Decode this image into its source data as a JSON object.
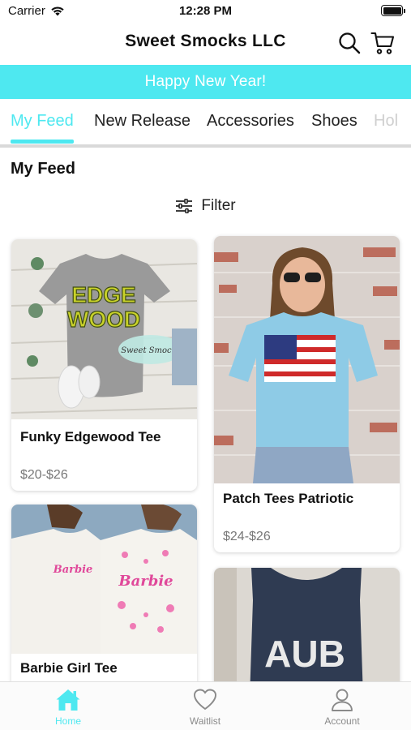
{
  "status_bar": {
    "carrier": "Carrier",
    "time": "12:28 PM"
  },
  "header": {
    "title": "Sweet Smocks LLC"
  },
  "banner": {
    "text": "Happy New Year!",
    "color": "#4ee8f0"
  },
  "tabs": [
    {
      "label": "My Feed",
      "active": true
    },
    {
      "label": "New Release"
    },
    {
      "label": "Accessories"
    },
    {
      "label": "Shoes"
    },
    {
      "label": "Hol"
    }
  ],
  "section_title": "My Feed",
  "filter_label": "Filter",
  "products": [
    {
      "name": "Funky Edgewood Tee",
      "price": "$20-$26",
      "image_text": [
        "EDGE",
        "WOOD"
      ],
      "logo_text": "Sweet Smocks"
    },
    {
      "name": "Patch Tees Patriotic",
      "price": "$24-$26"
    },
    {
      "name": "Barbie Girl Tee",
      "price": "",
      "image_text": [
        "Barbie",
        "Barbie"
      ]
    },
    {
      "name": "",
      "price": "",
      "image_text": [
        "AUB"
      ]
    }
  ],
  "bottom_nav": [
    {
      "label": "Home",
      "icon": "home-icon",
      "active": true
    },
    {
      "label": "Waitlist",
      "icon": "heart-icon"
    },
    {
      "label": "Account",
      "icon": "person-icon"
    }
  ],
  "colors": {
    "accent": "#4ee8f0",
    "text": "#111111",
    "price": "#777777"
  }
}
